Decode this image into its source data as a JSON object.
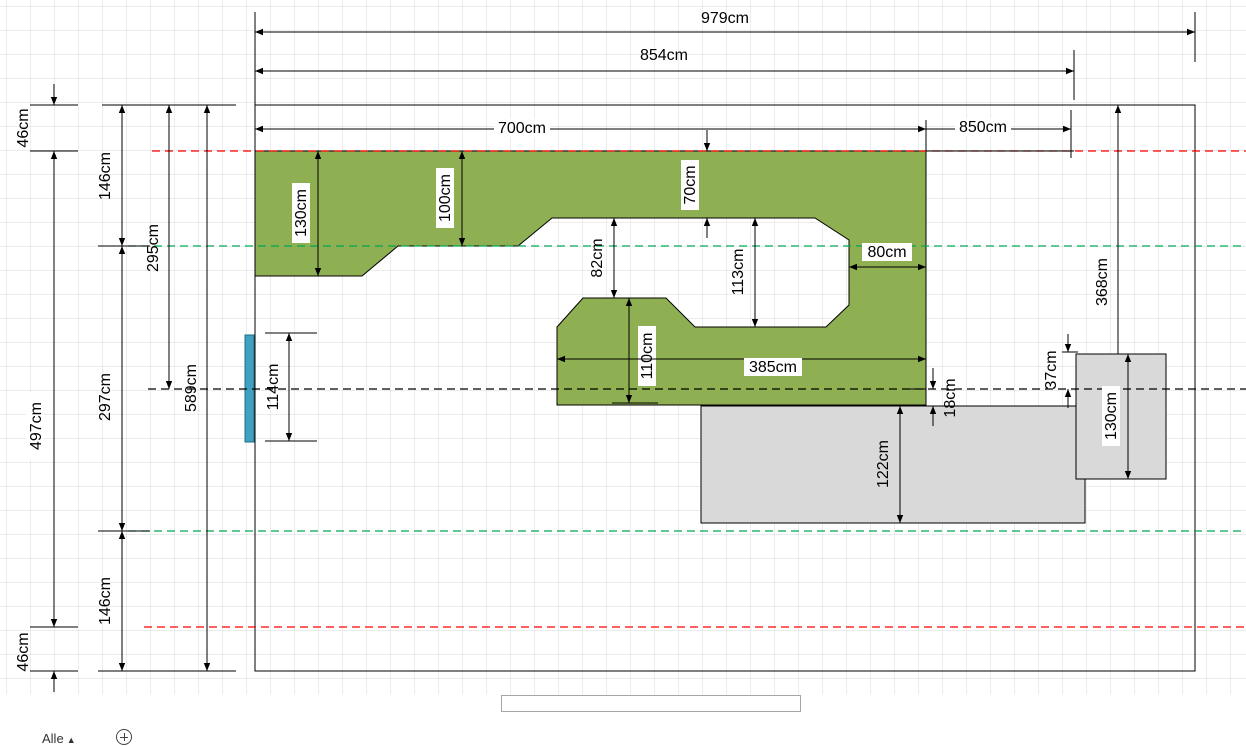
{
  "colors": {
    "grid": "#d9d9d9",
    "green_area": "#8fb052",
    "grey_area": "#d9d9d9",
    "door": "#3fa0c0",
    "red_guide": "#ff0000",
    "green_guide": "#00a651",
    "black_guide": "#000000",
    "outline": "#000000"
  },
  "labels": {
    "w979": "979cm",
    "w854": "854cm",
    "w700": "700cm",
    "w850": "850cm",
    "h46_top": "46cm",
    "h146_top": "146cm",
    "h295": "295cm",
    "h497": "497cm",
    "h297": "297cm",
    "h589": "589cm",
    "h146_bottom": "146cm",
    "h46_bottom": "46cm",
    "h130_left": "130cm",
    "h100": "100cm",
    "h70": "70cm",
    "h82": "82cm",
    "h113": "113cm",
    "w80": "80cm",
    "h110": "110cm",
    "w385": "385cm",
    "h114": "114cm",
    "h18": "18cm",
    "h122": "122cm",
    "h37": "37cm",
    "h130_right": "130cm",
    "h368": "368cm"
  },
  "sheet_tabs": {
    "all_label": "Alle",
    "all_caret": "▲"
  },
  "icons": {
    "add_page": "plus-circle-icon",
    "tab_caret": "caret-up-icon"
  }
}
